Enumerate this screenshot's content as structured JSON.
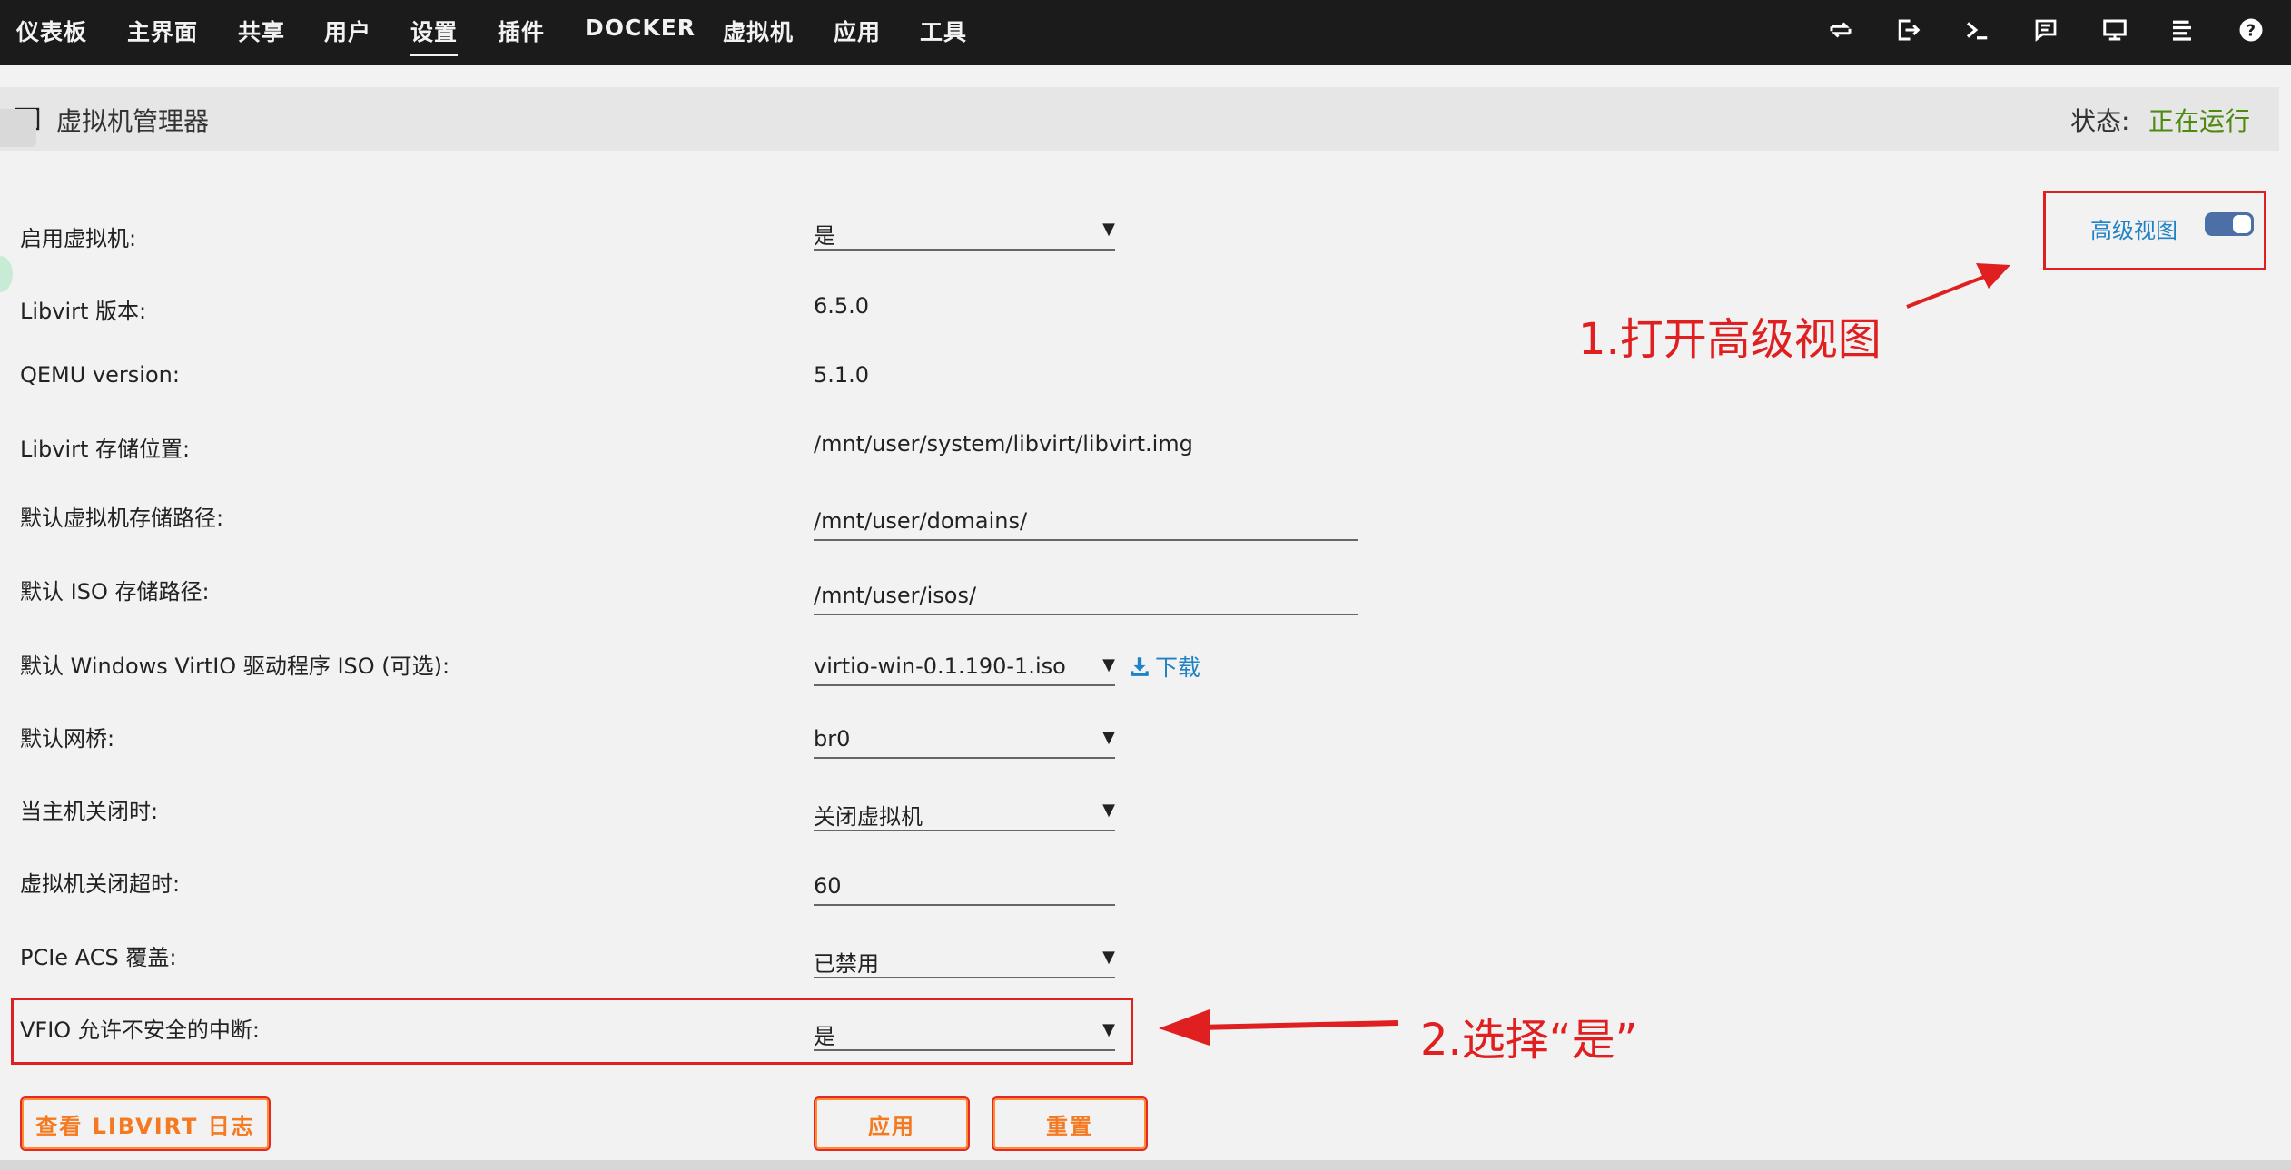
{
  "nav": {
    "items": [
      "仪表板",
      "主界面",
      "共享",
      "用户",
      "设置",
      "插件",
      "DOCKER",
      "虚拟机",
      "应用",
      "工具"
    ],
    "active": "设置",
    "right_icons": [
      "refresh-icon",
      "logout-icon",
      "terminal-icon",
      "feedback-icon",
      "display-icon",
      "log-icon",
      "help-icon"
    ]
  },
  "header": {
    "title": "虚拟机管理器",
    "status_label": "状态:",
    "status_value": "正在运行"
  },
  "advanced_view": {
    "label": "高级视图",
    "enabled": true
  },
  "form": {
    "enable_vm": {
      "label": "启用虚拟机:",
      "value": "是"
    },
    "libvirt_version": {
      "label": "Libvirt 版本:",
      "value": "6.5.0"
    },
    "qemu_version": {
      "label": "QEMU version:",
      "value": "5.1.0"
    },
    "libvirt_storage": {
      "label": "Libvirt 存储位置:",
      "value": "/mnt/user/system/libvirt/libvirt.img"
    },
    "default_vm_path": {
      "label": "默认虚拟机存储路径:",
      "value": "/mnt/user/domains/"
    },
    "default_iso_path": {
      "label": "默认 ISO 存储路径:",
      "value": "/mnt/user/isos/"
    },
    "virtio_iso": {
      "label": "默认 Windows VirtIO 驱动程序 ISO (可选):",
      "value": "virtio-win-0.1.190-1.iso",
      "download_label": "下载"
    },
    "default_bridge": {
      "label": "默认网桥:",
      "value": "br0"
    },
    "host_shutdown": {
      "label": "当主机关闭时:",
      "value": "关闭虚拟机"
    },
    "shutdown_timeout": {
      "label": "虚拟机关闭超时:",
      "value": "60"
    },
    "pcie_acs": {
      "label": "PCIe ACS 覆盖:",
      "value": "已禁用"
    },
    "vfio_unsafe": {
      "label": "VFIO 允许不安全的中断:",
      "value": "是"
    }
  },
  "buttons": {
    "view_log": "查看 LIBVIRT 日志",
    "apply": "应用",
    "reset": "重置"
  },
  "annotations": {
    "step1": "1.打开高级视图",
    "step2": "2.选择“是”"
  },
  "colors": {
    "nav_bg": "#1c1b1b",
    "status_green": "#4f8a10",
    "link_blue": "#1f82c4",
    "button_orange": "#f57920",
    "annotation_red": "#e02020"
  }
}
